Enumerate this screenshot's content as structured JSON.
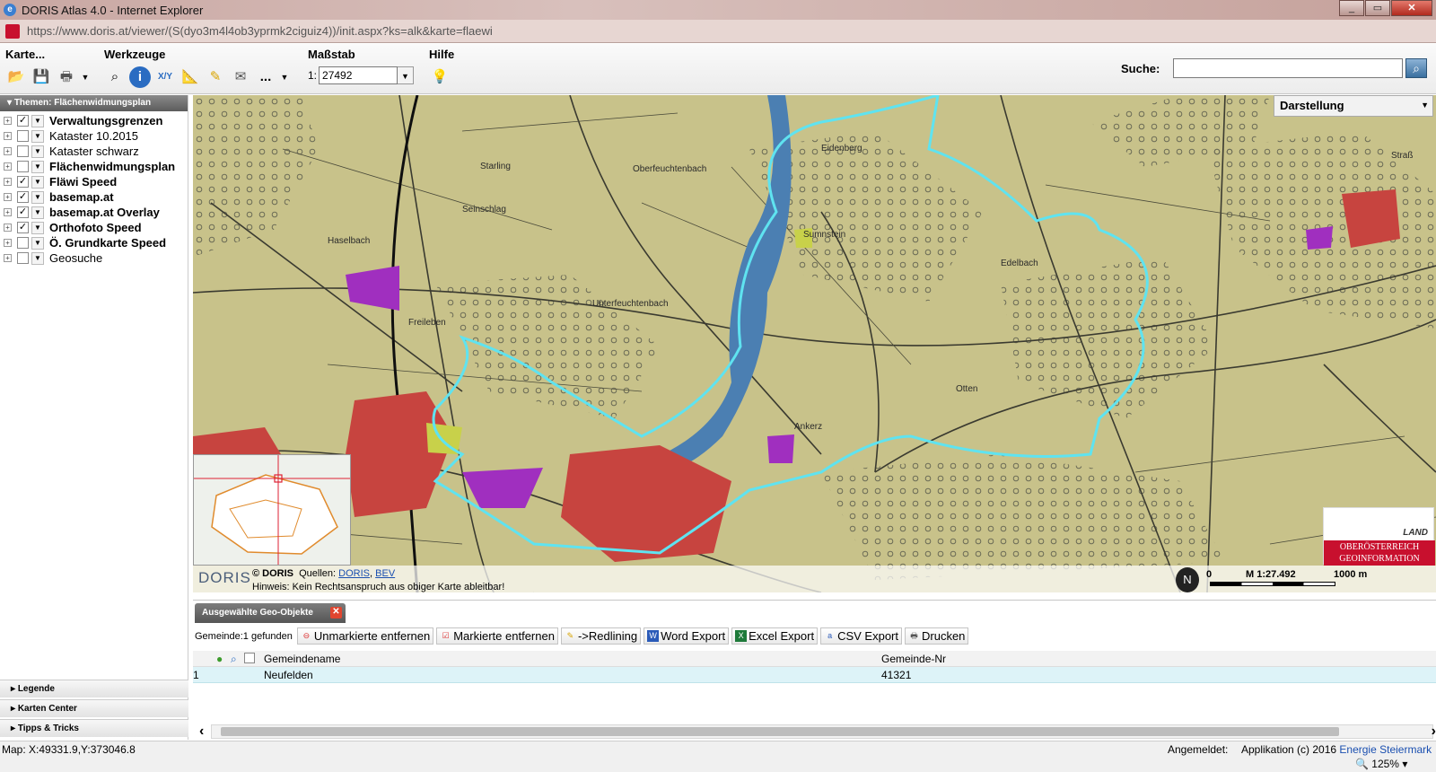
{
  "window": {
    "title": "DORIS Atlas 4.0 - Internet Explorer",
    "url": "https://www.doris.at/viewer/(S(dyo3m4l4ob3yprmk2ciguiz4))/init.aspx?ks=alk&karte=flaewi"
  },
  "toolbar": {
    "karte_label": "Karte...",
    "werkzeuge_label": "Werkzeuge",
    "massstab_label": "Maßstab",
    "hilfe_label": "Hilfe",
    "scale_prefix": "1:",
    "scale_value": "27492",
    "search_label": "Suche:",
    "search_value": "",
    "more_label": "..."
  },
  "sidebar": {
    "header": "Themen: Flächenwidmungsplan",
    "layers": [
      {
        "name": "Verwaltungsgrenzen",
        "checked": true,
        "bold": true
      },
      {
        "name": "Kataster 10.2015",
        "checked": false,
        "bold": false
      },
      {
        "name": "Kataster schwarz",
        "checked": false,
        "bold": false
      },
      {
        "name": "Flächenwidmungsplan",
        "checked": false,
        "bold": true
      },
      {
        "name": "Fläwi Speed",
        "checked": true,
        "bold": true
      },
      {
        "name": "basemap.at",
        "checked": true,
        "bold": true
      },
      {
        "name": "basemap.at Overlay",
        "checked": true,
        "bold": true
      },
      {
        "name": "Orthofoto Speed",
        "checked": true,
        "bold": true
      },
      {
        "name": "Ö. Grundkarte Speed",
        "checked": false,
        "bold": true
      },
      {
        "name": "Geosuche",
        "checked": false,
        "bold": false
      }
    ],
    "accordion": [
      "Legende",
      "Karten Center",
      "Tipps & Tricks"
    ]
  },
  "map": {
    "darstellung": "Darstellung",
    "labels": [
      "Oberfeuchtenbach",
      "Unterfeuchtenbach",
      "Freileben",
      "Haselbach",
      "Sumnstein",
      "Otten",
      "Starling",
      "Seinschlag",
      "Straß",
      "Edelbach",
      "Ankerz",
      "Eidenberg"
    ],
    "copyright_prefix": "© DORIS",
    "sources_label": "Quellen:",
    "source_links": [
      "DORIS",
      "BEV"
    ],
    "hint": "Hinweis: Kein Rechtsanspruch aus obiger Karte ableitbar!",
    "scale_zero": "0",
    "scale_text": "M 1:27.492",
    "scale_end": "1000 m",
    "north": "N",
    "logo_land": "LAND",
    "logo_line1": "OBERÖSTERREICH",
    "logo_line2": "GEOINFORMATION",
    "doris_logo": "DORIS"
  },
  "results": {
    "tab_label": "Ausgewählte Geo-Objekte",
    "count": "Gemeinde:1 gefunden",
    "buttons": [
      "Unmarkierte entfernen",
      "Markierte entfernen",
      "->Redlining",
      "Word Export",
      "Excel Export",
      "CSV Export",
      "Drucken"
    ],
    "columns": [
      "Gemeindename",
      "Gemeinde-Nr"
    ],
    "rows": [
      {
        "idx": "1",
        "name": "Neufelden",
        "nr": "41321"
      }
    ]
  },
  "status": {
    "coords": "Map: X:49331.9,Y:373046.8",
    "angemeldet": "Angemeldet:",
    "app": "Applikation (c) 2016",
    "link": "Energie Steiermark",
    "zoom": "125%"
  },
  "colors": {
    "boundary": "#5fe3f0",
    "settlement": "#d0443f",
    "commercial": "#a02fbf",
    "base": "#c9c48a"
  }
}
